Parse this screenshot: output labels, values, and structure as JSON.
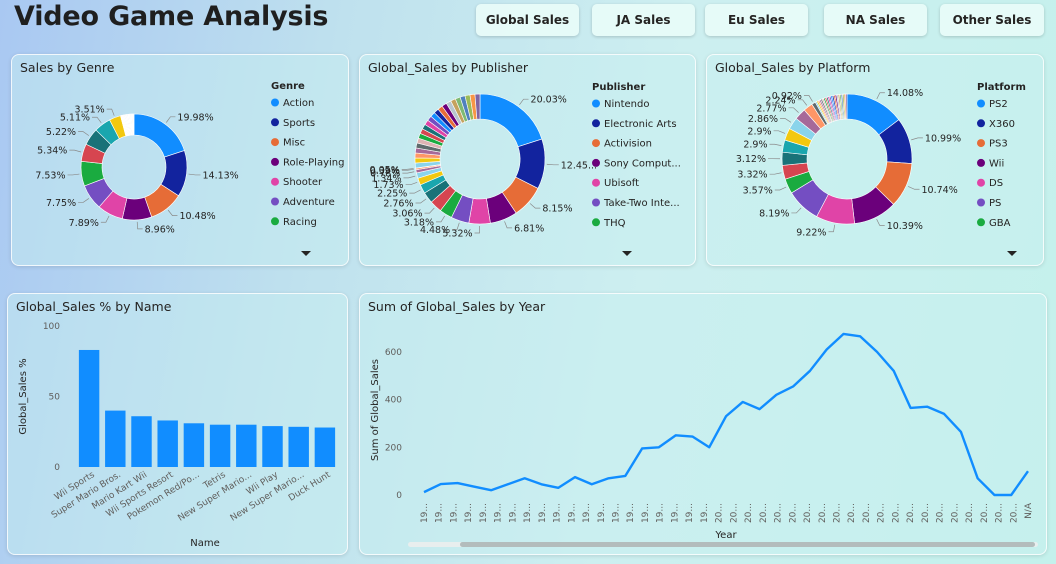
{
  "header": {
    "title": "Video Game Analysis",
    "buttons": [
      "Global Sales",
      "JA Sales",
      "Eu Sales",
      "NA Sales",
      "Other Sales"
    ]
  },
  "colors": {
    "palette": [
      "#118DFF",
      "#12239E",
      "#E66C37",
      "#6B007B",
      "#E044A7",
      "#744EC2",
      "#1AAB40",
      "#D64550",
      "#197278",
      "#1AA6AE",
      "#F2C80F",
      "#8AD4EB",
      "#A66999",
      "#FE9666",
      "#5F6B6D",
      "#DEB4B4"
    ],
    "line": "#118DFF",
    "bar": "#118DFF"
  },
  "genre": {
    "title": "Sales by Genre",
    "legend_title": "Genre",
    "legend": [
      "Action",
      "Sports",
      "Misc",
      "Role-Playing",
      "Shooter",
      "Adventure",
      "Racing"
    ],
    "more_icon": "chevron-down-icon",
    "chart_data": {
      "type": "pie",
      "slices": [
        {
          "pct": 19.98,
          "label": "19.98%"
        },
        {
          "pct": 14.13,
          "label": "14.13%"
        },
        {
          "pct": 10.48,
          "label": "10.48%"
        },
        {
          "pct": 8.96,
          "label": "8.96%"
        },
        {
          "pct": 7.89,
          "label": "7.89%"
        },
        {
          "pct": 7.75,
          "label": "7.75%"
        },
        {
          "pct": 7.53,
          "label": "7.53%"
        },
        {
          "pct": 5.34,
          "label": "5.34%"
        },
        {
          "pct": 5.22,
          "label": "5.22%"
        },
        {
          "pct": 5.11,
          "label": "5.11%"
        },
        {
          "pct": 3.51,
          "label": "3.51%"
        },
        {
          "pct": 4.1,
          "label": ""
        }
      ]
    }
  },
  "publisher": {
    "title": "Global_Sales by Publisher",
    "legend_title": "Publisher",
    "legend": [
      "Nintendo",
      "Electronic Arts",
      "Activision",
      "Sony Comput...",
      "Ubisoft",
      "Take-Two Inte...",
      "THQ"
    ],
    "more_icon": "chevron-down-icon",
    "chart_data": {
      "type": "pie",
      "slices": [
        {
          "pct": 20.03,
          "label": "20.03%"
        },
        {
          "pct": 12.45,
          "label": "12.45..."
        },
        {
          "pct": 8.15,
          "label": "8.15%"
        },
        {
          "pct": 6.81,
          "label": "6.81%"
        },
        {
          "pct": 5.32,
          "label": "5.32%"
        },
        {
          "pct": 4.48,
          "label": "4.48%"
        },
        {
          "pct": 3.18,
          "label": "3.18%"
        },
        {
          "pct": 3.06,
          "label": "3.06%"
        },
        {
          "pct": 2.76,
          "label": "2.76%"
        },
        {
          "pct": 2.25,
          "label": "2.25%"
        },
        {
          "pct": 1.73,
          "label": "1.73%"
        },
        {
          "pct": 1.34,
          "label": "1.34%"
        },
        {
          "pct": 0.78,
          "label": "0.78%"
        },
        {
          "pct": 0.39,
          "label": "0.39%"
        },
        {
          "pct": 0.05,
          "label": "0.05%"
        },
        {
          "pct": 27.22,
          "label": ""
        }
      ]
    }
  },
  "platform": {
    "title": "Global_Sales by Platform",
    "legend_title": "Platform",
    "legend": [
      "PS2",
      "X360",
      "PS3",
      "Wii",
      "DS",
      "PS",
      "GBA"
    ],
    "more_icon": "chevron-down-icon",
    "chart_data": {
      "type": "pie",
      "slices": [
        {
          "pct": 14.08,
          "label": "14.08%"
        },
        {
          "pct": 10.99,
          "label": "10.99%"
        },
        {
          "pct": 10.74,
          "label": "10.74%"
        },
        {
          "pct": 10.39,
          "label": "10.39%"
        },
        {
          "pct": 9.22,
          "label": "9.22%"
        },
        {
          "pct": 8.19,
          "label": "8.19%"
        },
        {
          "pct": 3.57,
          "label": "3.57%"
        },
        {
          "pct": 3.32,
          "label": "3.32%"
        },
        {
          "pct": 3.12,
          "label": "3.12%"
        },
        {
          "pct": 2.9,
          "label": "2.9%"
        },
        {
          "pct": 2.9,
          "label": "2.9%"
        },
        {
          "pct": 2.86,
          "label": "2.86%"
        },
        {
          "pct": 2.77,
          "label": "2.77%"
        },
        {
          "pct": 2.24,
          "label": "2.24%"
        },
        {
          "pct": 0.92,
          "label": "0.92%"
        },
        {
          "pct": 7.79,
          "label": ""
        }
      ]
    }
  },
  "name_chart": {
    "title": "Global_Sales % by Name",
    "chart_data": {
      "type": "bar",
      "categories": [
        "Wii Sports",
        "Super Mario Bros.",
        "Mario Kart Wii",
        "Wii Sports Resort",
        "Pokemon Red/Po...",
        "Tetris",
        "New Super Mario...",
        "Wii Play",
        "New Super Mario...",
        "Duck Hunt"
      ],
      "values": [
        83,
        40,
        36,
        33,
        31,
        30,
        30,
        29,
        28.5,
        28
      ],
      "xlabel": "Name",
      "ylabel": "Global_Sales %",
      "ylim": [
        0,
        100
      ],
      "yticks": [
        "0",
        "50",
        "100"
      ]
    }
  },
  "year_chart": {
    "title": "Sum of Global_Sales by Year",
    "chart_data": {
      "type": "line",
      "x": [
        "19...",
        "19...",
        "19...",
        "19...",
        "19...",
        "19...",
        "19...",
        "19...",
        "19...",
        "19...",
        "19...",
        "19...",
        "19...",
        "19...",
        "19...",
        "19...",
        "19...",
        "19...",
        "19...",
        "19...",
        "20...",
        "20...",
        "20...",
        "20...",
        "20...",
        "20...",
        "20...",
        "20...",
        "20...",
        "20...",
        "20...",
        "20...",
        "20...",
        "20...",
        "20...",
        "20...",
        "20...",
        "20...",
        "20...",
        "20...",
        "20...",
        "N/A"
      ],
      "values": [
        12,
        46,
        50,
        35,
        20,
        45,
        70,
        45,
        30,
        75,
        45,
        70,
        80,
        195,
        200,
        250,
        245,
        200,
        330,
        390,
        360,
        420,
        455,
        520,
        610,
        675,
        665,
        600,
        520,
        365,
        370,
        340,
        265,
        70,
        0,
        0,
        100
      ],
      "xlabel": "Year",
      "ylabel": "Sum of Global_Sales",
      "ylim": [
        0,
        700
      ],
      "yticks": [
        "0",
        "200",
        "400",
        "600"
      ]
    }
  }
}
